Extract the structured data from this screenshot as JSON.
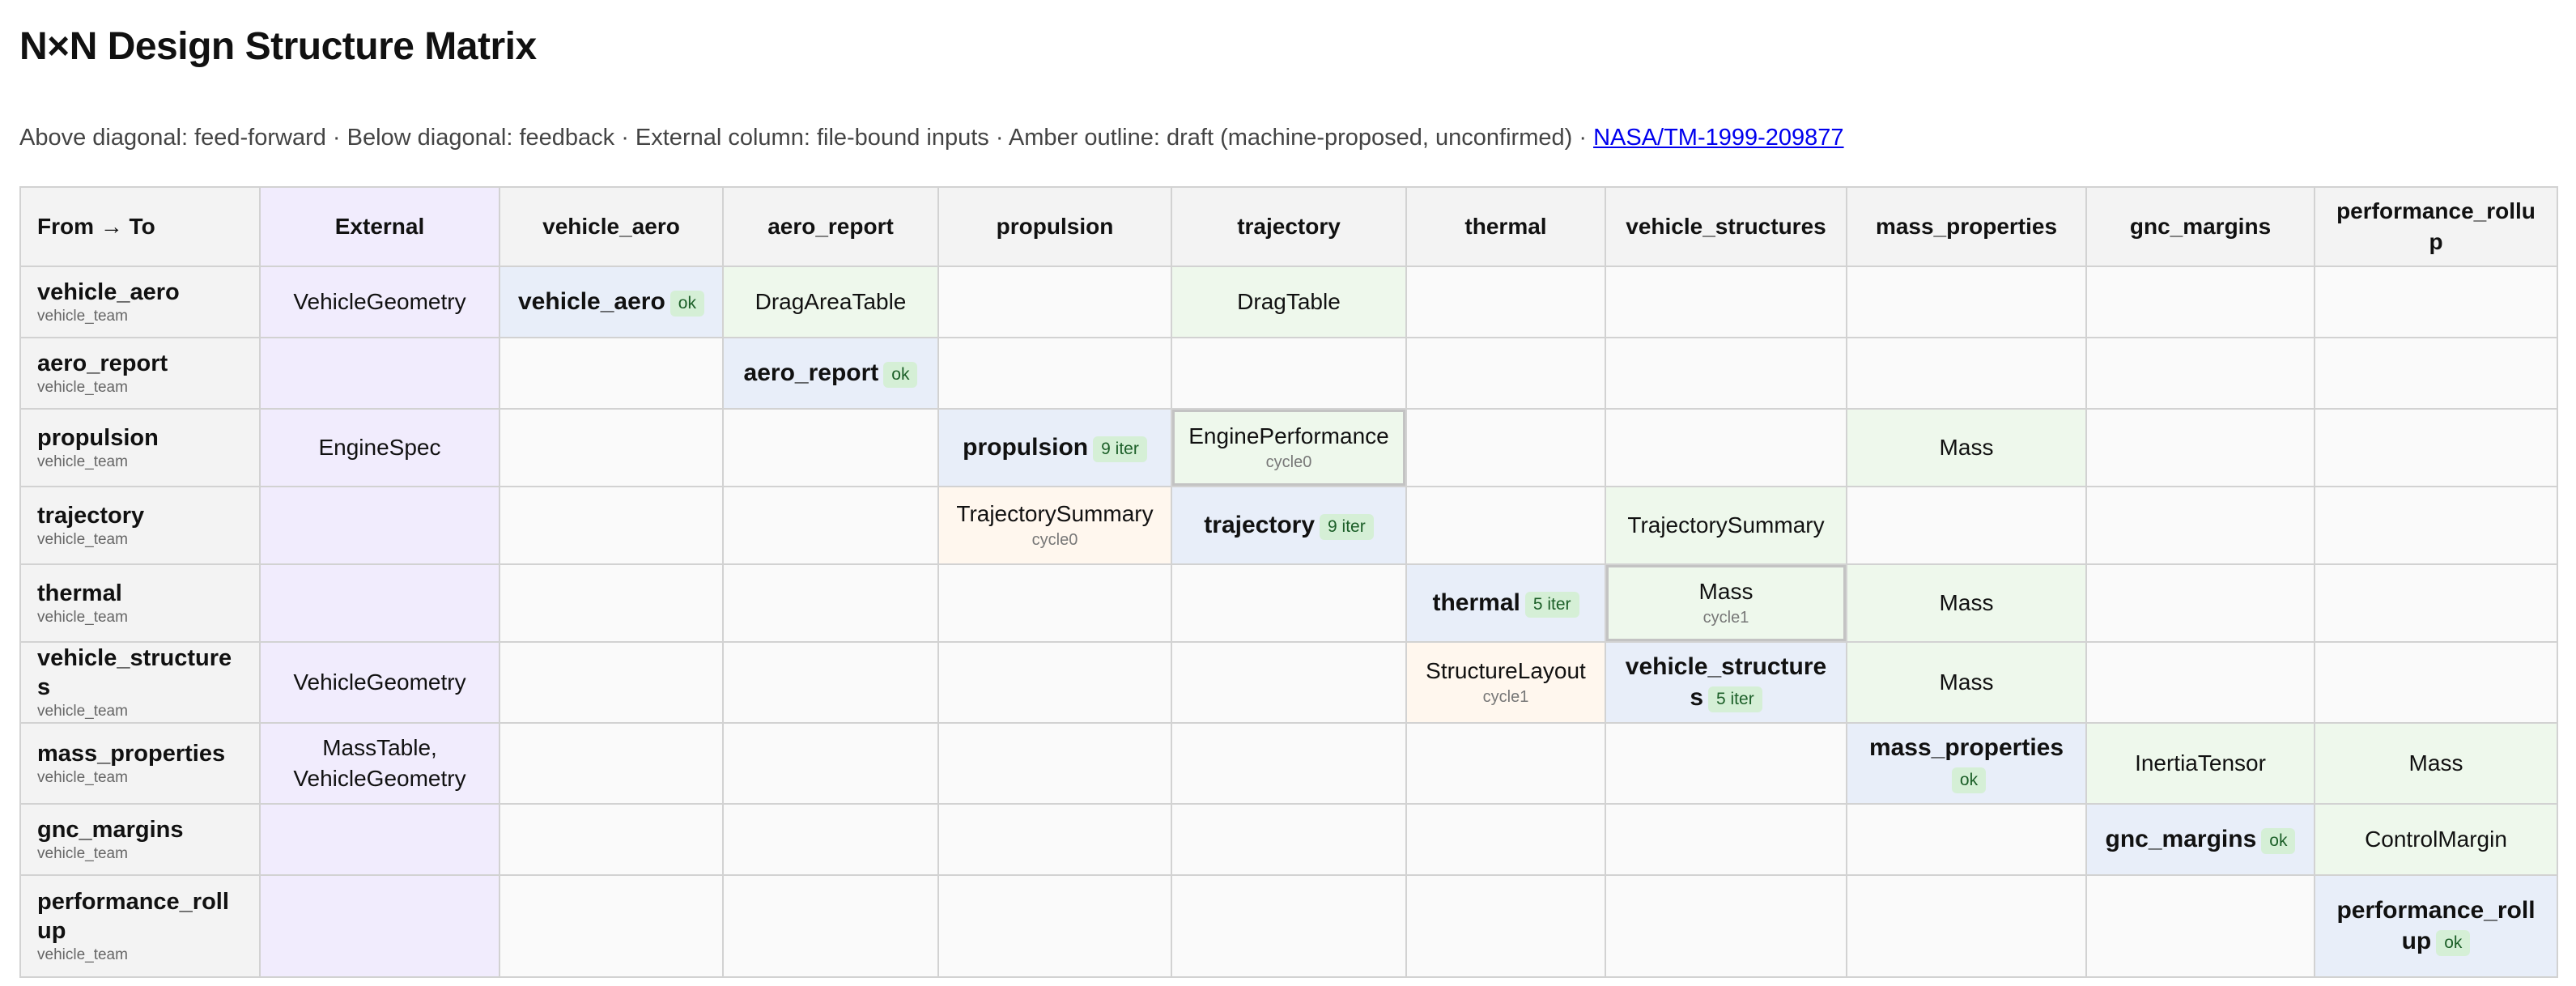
{
  "page": {
    "title": "N×N Design Structure Matrix",
    "legend_text": "Above diagonal: feed-forward · Below diagonal: feedback · External column: file-bound inputs · Amber outline: draft (machine-proposed, unconfirmed) · ",
    "legend_link": "NASA/TM-1999-209877"
  },
  "colors": {
    "external_column": "#f1ecfd",
    "diagonal": "#e8eef9",
    "feed_forward": "#eef8ec",
    "draft_outline": "#d7b58f",
    "badge": "#d5efd6",
    "link": "#0000ee"
  },
  "table": {
    "corner_label": "From → To",
    "columns": [
      "External",
      "vehicle_aero",
      "aero_report",
      "propulsion",
      "trajectory",
      "thermal",
      "vehicle_structures",
      "mass_properties",
      "gnc_margins",
      "performance_rollup"
    ],
    "rows": [
      {
        "name": "vehicle_aero",
        "team": "vehicle_team",
        "external": "VehicleGeometry",
        "cells": [
          {
            "kind": "diag",
            "label": "vehicle_aero",
            "badge": "ok"
          },
          {
            "kind": "ff",
            "label": "DragAreaTable"
          },
          {
            "kind": "empty"
          },
          {
            "kind": "ff",
            "label": "DragTable"
          },
          {
            "kind": "empty"
          },
          {
            "kind": "empty"
          },
          {
            "kind": "empty"
          },
          {
            "kind": "empty"
          },
          {
            "kind": "empty"
          }
        ]
      },
      {
        "name": "aero_report",
        "team": "vehicle_team",
        "external": "",
        "cells": [
          {
            "kind": "empty"
          },
          {
            "kind": "diag",
            "label": "aero_report",
            "badge": "ok"
          },
          {
            "kind": "empty"
          },
          {
            "kind": "empty"
          },
          {
            "kind": "empty"
          },
          {
            "kind": "empty"
          },
          {
            "kind": "empty"
          },
          {
            "kind": "empty"
          },
          {
            "kind": "empty"
          }
        ]
      },
      {
        "name": "propulsion",
        "team": "vehicle_team",
        "external": "EngineSpec",
        "cells": [
          {
            "kind": "empty"
          },
          {
            "kind": "empty"
          },
          {
            "kind": "diag",
            "label": "propulsion",
            "badge": "9 iter"
          },
          {
            "kind": "ff-cyc",
            "label": "EnginePerformance",
            "sub": "cycle0"
          },
          {
            "kind": "empty"
          },
          {
            "kind": "empty"
          },
          {
            "kind": "ff",
            "label": "Mass"
          },
          {
            "kind": "empty"
          },
          {
            "kind": "empty"
          }
        ]
      },
      {
        "name": "trajectory",
        "team": "vehicle_team",
        "external": "",
        "cells": [
          {
            "kind": "empty"
          },
          {
            "kind": "empty"
          },
          {
            "kind": "fb",
            "label": "TrajectorySummary",
            "sub": "cycle0"
          },
          {
            "kind": "diag",
            "label": "trajectory",
            "badge": "9 iter"
          },
          {
            "kind": "empty"
          },
          {
            "kind": "ff",
            "label": "TrajectorySummary"
          },
          {
            "kind": "empty"
          },
          {
            "kind": "empty"
          },
          {
            "kind": "empty"
          }
        ]
      },
      {
        "name": "thermal",
        "team": "vehicle_team",
        "external": "",
        "cells": [
          {
            "kind": "empty"
          },
          {
            "kind": "empty"
          },
          {
            "kind": "empty"
          },
          {
            "kind": "empty"
          },
          {
            "kind": "diag",
            "label": "thermal",
            "badge": "5 iter"
          },
          {
            "kind": "ff-cyc",
            "label": "Mass",
            "sub": "cycle1"
          },
          {
            "kind": "ff",
            "label": "Mass"
          },
          {
            "kind": "empty"
          },
          {
            "kind": "empty"
          }
        ]
      },
      {
        "name": "vehicle_structures",
        "team": "vehicle_team",
        "external": "VehicleGeometry",
        "cells": [
          {
            "kind": "empty"
          },
          {
            "kind": "empty"
          },
          {
            "kind": "empty"
          },
          {
            "kind": "empty"
          },
          {
            "kind": "fb",
            "label": "StructureLayout",
            "sub": "cycle1"
          },
          {
            "kind": "diag",
            "label": "vehicle_structures",
            "badge": "5 iter"
          },
          {
            "kind": "ff",
            "label": "Mass"
          },
          {
            "kind": "empty"
          },
          {
            "kind": "empty"
          }
        ]
      },
      {
        "name": "mass_properties",
        "team": "vehicle_team",
        "external": "MassTable, VehicleGeometry",
        "cells": [
          {
            "kind": "empty"
          },
          {
            "kind": "empty"
          },
          {
            "kind": "empty"
          },
          {
            "kind": "empty"
          },
          {
            "kind": "empty"
          },
          {
            "kind": "empty"
          },
          {
            "kind": "diag",
            "label": "mass_properties",
            "badge": "ok"
          },
          {
            "kind": "ff",
            "label": "InertiaTensor"
          },
          {
            "kind": "ff",
            "label": "Mass"
          }
        ]
      },
      {
        "name": "gnc_margins",
        "team": "vehicle_team",
        "external": "",
        "cells": [
          {
            "kind": "empty"
          },
          {
            "kind": "empty"
          },
          {
            "kind": "empty"
          },
          {
            "kind": "empty"
          },
          {
            "kind": "empty"
          },
          {
            "kind": "empty"
          },
          {
            "kind": "empty"
          },
          {
            "kind": "diag",
            "label": "gnc_margins",
            "badge": "ok"
          },
          {
            "kind": "ff",
            "label": "ControlMargin"
          }
        ]
      },
      {
        "name": "performance_rollup",
        "team": "vehicle_team",
        "external": "",
        "cells": [
          {
            "kind": "empty"
          },
          {
            "kind": "empty"
          },
          {
            "kind": "empty"
          },
          {
            "kind": "empty"
          },
          {
            "kind": "empty"
          },
          {
            "kind": "empty"
          },
          {
            "kind": "empty"
          },
          {
            "kind": "empty"
          },
          {
            "kind": "diag",
            "label": "performance_rollup",
            "badge": "ok"
          }
        ]
      }
    ]
  }
}
